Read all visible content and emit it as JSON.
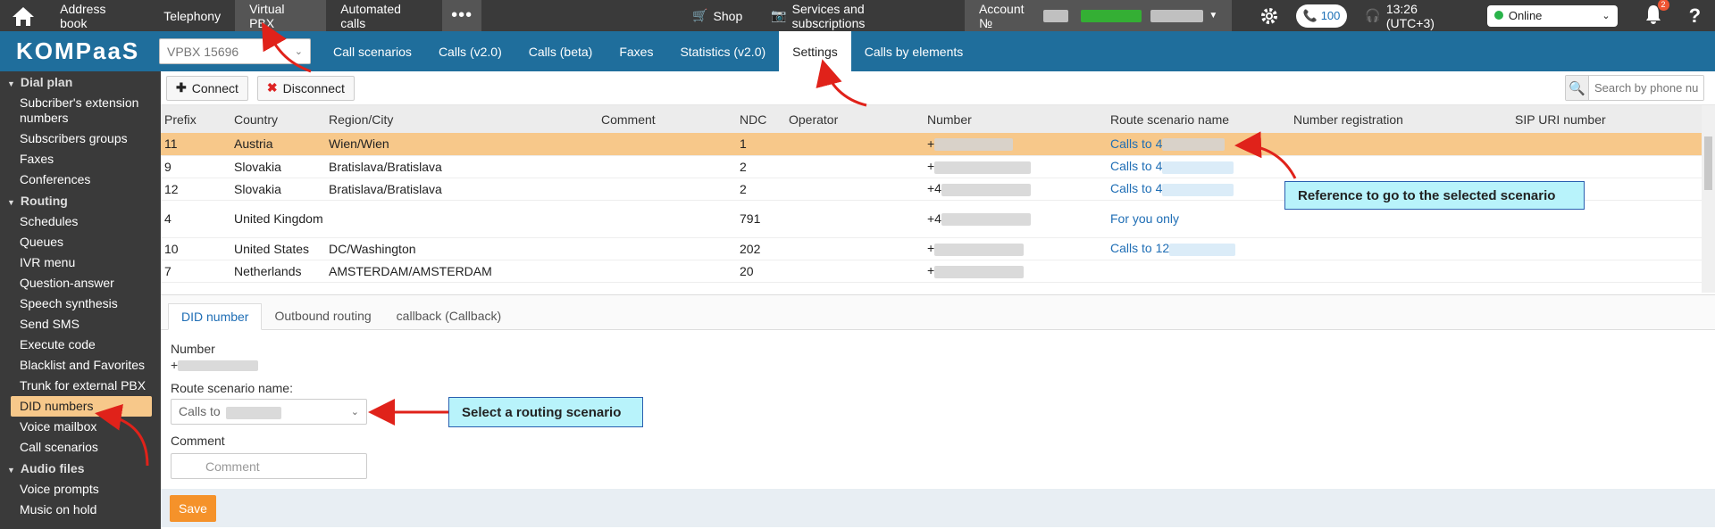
{
  "topbar": {
    "home_icon": "home-icon",
    "nav": [
      {
        "label": "Address book"
      },
      {
        "label": "Telephony"
      },
      {
        "label": "Virtual PBX"
      },
      {
        "label": "Automated calls"
      }
    ],
    "more": "•••",
    "shop": "Shop",
    "services": "Services and subscriptions",
    "account": "Account №",
    "call_count": "100",
    "time": "13:26 (UTC+3)",
    "status": "Online",
    "notif_count": "2",
    "help": "?"
  },
  "secbar": {
    "logo": "KOMPaaS",
    "vpbx": "VPBX 15696",
    "tabs": [
      "Call scenarios",
      "Calls (v2.0)",
      "Calls (beta)",
      "Faxes",
      "Statistics (v2.0)",
      "Settings",
      "Calls by elements"
    ]
  },
  "sidebar": {
    "groups": [
      {
        "title": "Dial plan",
        "items": [
          "Subcriber's extension numbers",
          "Subscribers groups",
          "Faxes",
          "Conferences"
        ]
      },
      {
        "title": "Routing",
        "items": [
          "Schedules",
          "Queues",
          "IVR menu",
          "Question-answer",
          "Speech synthesis",
          "Send SMS",
          "Execute code",
          "Blacklist and Favorites",
          "Trunk for external PBX",
          "DID numbers",
          "Voice mailbox",
          "Call scenarios"
        ]
      },
      {
        "title": "Audio files",
        "items": [
          "Voice prompts",
          "Music on hold"
        ]
      }
    ]
  },
  "toolbar": {
    "connect": "Connect",
    "disconnect": "Disconnect",
    "search_placeholder": "Search by phone nu"
  },
  "table": {
    "headers": [
      "Prefix",
      "Country",
      "Region/City",
      "Comment",
      "NDC",
      "Operator",
      "Number",
      "Route scenario name",
      "Number registration",
      "SIP URI number"
    ],
    "rows": [
      [
        "11",
        "Austria",
        "Wien/Wien",
        "",
        "1",
        "",
        "+",
        "Calls to 4",
        "",
        ""
      ],
      [
        "9",
        "Slovakia",
        "Bratislava/Bratislava",
        "",
        "2",
        "",
        "+",
        "Calls to 4",
        "",
        ""
      ],
      [
        "12",
        "Slovakia",
        "Bratislava/Bratislava",
        "",
        "2",
        "",
        "+4",
        "Calls to 4",
        "",
        ""
      ],
      [
        "4",
        "United Kingdom",
        "",
        "",
        "791",
        "",
        "+4",
        "For you only",
        "",
        ""
      ],
      [
        "10",
        "United States",
        "DC/Washington",
        "",
        "202",
        "",
        "+",
        "Calls to 12",
        "",
        ""
      ],
      [
        "7",
        "Netherlands",
        "AMSTERDAM/AMSTERDAM",
        "",
        "20",
        "",
        "+",
        "",
        "",
        ""
      ]
    ]
  },
  "callout1": "Reference to go to the selected scenario",
  "callout2": "Select a routing scenario",
  "bottom": {
    "tabs": [
      "DID number",
      "Outbound routing",
      "callback (Callback)"
    ],
    "number_label": "Number",
    "number_value": "+",
    "route_label": "Route scenario name:",
    "route_value": "Calls to",
    "comment_label": "Comment",
    "comment_placeholder": "Comment",
    "save": "Save"
  }
}
